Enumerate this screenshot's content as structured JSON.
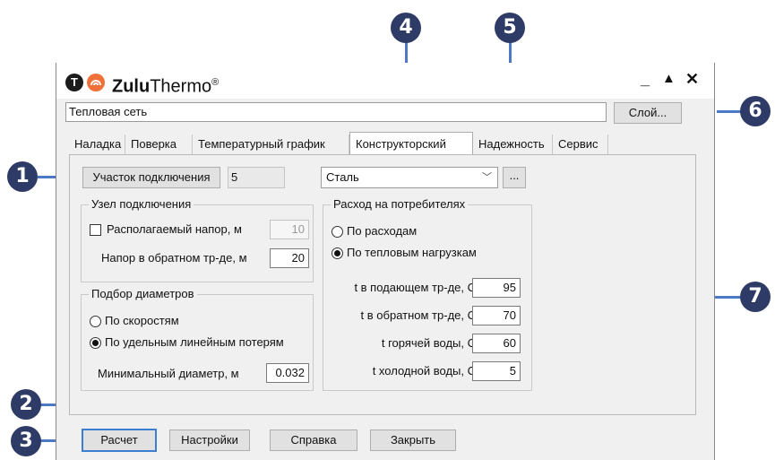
{
  "window": {
    "title_bold": "Zulu",
    "title_rest": "Thermo",
    "title_reg": "®",
    "logo_letter": "T",
    "minimize": "_",
    "maximize": "▲",
    "close": "✕"
  },
  "network": {
    "value": "Тепловая сеть",
    "layer_button": "Слой..."
  },
  "tabs": [
    "Наладка",
    "Поверка",
    "Температурный график",
    "Конструкторский",
    "Надежность",
    "Сервис"
  ],
  "active_tab": "Конструкторский",
  "segment": {
    "button": "Участок подключения",
    "value": "5"
  },
  "material": {
    "value": "Сталь",
    "browse_button": "..."
  },
  "node": {
    "title": "Узел подключения",
    "available_head_label": "Располагаемый напор, м",
    "available_head_value": "10",
    "return_head_label": "Напор в обратном тр-де, м",
    "return_head_value": "20"
  },
  "diameters": {
    "title": "Подбор диаметров",
    "option_speed": "По скоростям",
    "option_losses": "По удельным линейным потерям",
    "min_diameter_label": "Минимальный диаметр, м",
    "min_diameter_value": "0.032"
  },
  "consumers": {
    "title": "Расход на потребителях",
    "option_flow": "По расходам",
    "option_load": "По тепловым нагрузкам",
    "rows": [
      {
        "label": "t в подающем тр-де, С",
        "value": "95"
      },
      {
        "label": "t в обратном тр-де, С",
        "value": "70"
      },
      {
        "label": "t горячей воды, С",
        "value": "60"
      },
      {
        "label": "t холодной воды, С",
        "value": "5"
      }
    ]
  },
  "buttons": {
    "calc": "Расчет",
    "settings": "Настройки",
    "help": "Справка",
    "close": "Закрыть"
  },
  "callouts": [
    "1",
    "2",
    "3",
    "4",
    "5",
    "6",
    "7"
  ],
  "colors": {
    "callout": "#2e3b66",
    "leader_line": "#4d78c4",
    "logo_orange": "#f0703a",
    "focus": "#3c7fd1"
  }
}
